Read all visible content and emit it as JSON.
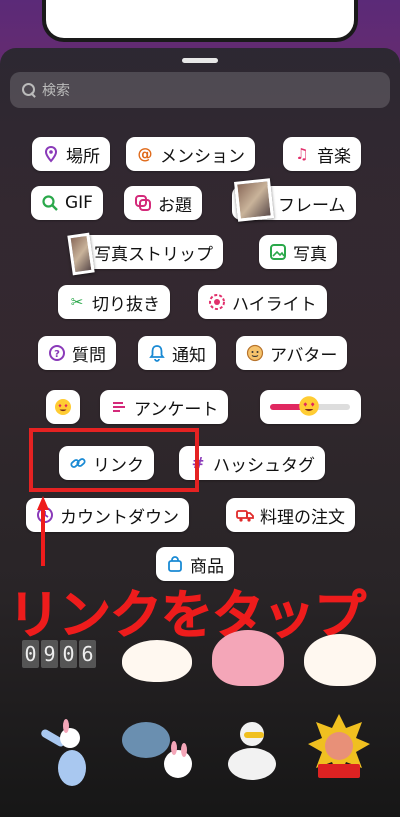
{
  "search": {
    "placeholder": "検索"
  },
  "stickers": {
    "location": "場所",
    "mention": "メンション",
    "music": "音楽",
    "gif": "GIF",
    "topic": "お題",
    "frame": "フレーム",
    "photo_strip": "写真ストリップ",
    "photo": "写真",
    "cutout": "切り抜き",
    "highlight": "ハイライト",
    "question": "質問",
    "notify": "通知",
    "avatar": "アバター",
    "poll": "アンケート",
    "link": "リンク",
    "hashtag": "ハッシュタグ",
    "countdown": "カウントダウン",
    "food_order": "料理の注文",
    "product": "商品"
  },
  "annotation": {
    "text": "リンクをタップ"
  },
  "counter_digits": [
    "0",
    "9",
    "0",
    "6"
  ],
  "colors": {
    "highlight": "#e52222",
    "accent_purple": "#8a3ab9",
    "accent_pink": "#e1306c"
  }
}
